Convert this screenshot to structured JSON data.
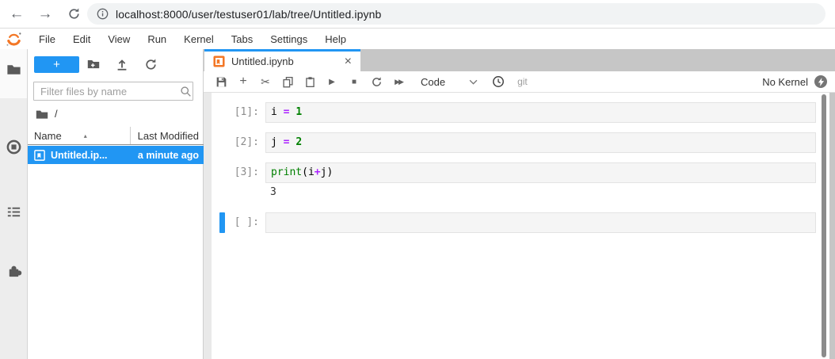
{
  "browser": {
    "url": "localhost:8000/user/testuser01/lab/tree/Untitled.ipynb",
    "back_glyph": "←",
    "forward_glyph": "→"
  },
  "menu": {
    "items": [
      {
        "label": "File"
      },
      {
        "label": "Edit"
      },
      {
        "label": "View"
      },
      {
        "label": "Run"
      },
      {
        "label": "Kernel"
      },
      {
        "label": "Tabs"
      },
      {
        "label": "Settings"
      },
      {
        "label": "Help"
      }
    ]
  },
  "filebrowser": {
    "new_button_label": "+",
    "filter_placeholder": "Filter files by name",
    "breadcrumb_root": "/",
    "header": {
      "name": "Name",
      "sort_glyph": "▴",
      "modified": "Last Modified"
    },
    "file": {
      "name": "Untitled.ip...",
      "modified": "a minute ago"
    }
  },
  "tab": {
    "title": "Untitled.ipynb",
    "close_glyph": "×"
  },
  "toolbar": {
    "add_glyph": "+",
    "cut_glyph": "✂",
    "run_glyph": "▶",
    "stop_glyph": "■",
    "ffwd_glyph": "▶▶",
    "cell_type": "Code",
    "git_label": "git",
    "kernel_status": "No Kernel"
  },
  "notebook": {
    "cells": [
      {
        "prompt": "[1]:",
        "code": [
          "i ",
          "= ",
          "1"
        ]
      },
      {
        "prompt": "[2]:",
        "code": [
          "j ",
          "= ",
          "2"
        ]
      },
      {
        "prompt": "[3]:",
        "code": [
          "print",
          "(i",
          "+",
          "j)"
        ],
        "output": "3"
      },
      {
        "prompt": "[ ]:",
        "code": []
      }
    ]
  },
  "colors": {
    "accent": "#2196f3",
    "jupyter_orange": "#f37726",
    "selection_blue": "#2196f3"
  }
}
